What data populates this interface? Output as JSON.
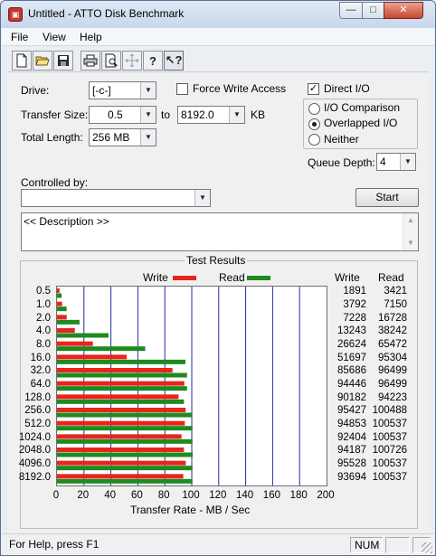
{
  "window": {
    "title": "Untitled - ATTO Disk Benchmark"
  },
  "menu": [
    "File",
    "View",
    "Help"
  ],
  "toolbar_icons": [
    "new-file-icon",
    "open-folder-icon",
    "save-icon",
    "print-icon",
    "print-preview-icon",
    "move-icon",
    "help-icon",
    "context-help-icon"
  ],
  "form": {
    "drive_label": "Drive:",
    "drive_value": "[-c-]",
    "force_write_label": "Force Write Access",
    "force_write_checked": false,
    "direct_io_label": "Direct I/O",
    "direct_io_checked": true,
    "transfer_size_label": "Transfer Size:",
    "transfer_from": "0.5",
    "to_label": "to",
    "transfer_to": "8192.0",
    "kb_label": "KB",
    "total_length_label": "Total Length:",
    "total_length_value": "256 MB",
    "io_options": [
      "I/O Comparison",
      "Overlapped I/O",
      "Neither"
    ],
    "io_selected": "Overlapped I/O",
    "queue_depth_label": "Queue Depth:",
    "queue_depth_value": "4",
    "controlled_by_label": "Controlled by:",
    "controlled_by_value": "",
    "start_label": "Start",
    "description": "<< Description >>"
  },
  "results": {
    "title": "Test Results",
    "write_label": "Write",
    "read_label": "Read",
    "write_color": "#e8251c",
    "read_color": "#1f8a1f",
    "axis_label": "Transfer Rate - MB / Sec"
  },
  "chart_data": {
    "type": "bar",
    "title": "Test Results",
    "xlabel": "Transfer Rate - MB / Sec",
    "ylabel": "",
    "xlim": [
      0,
      200
    ],
    "x_ticks": [
      0,
      20,
      40,
      60,
      80,
      100,
      120,
      140,
      160,
      180,
      200
    ],
    "grid": true,
    "legend": "top",
    "categories": [
      "0.5",
      "1.0",
      "2.0",
      "4.0",
      "8.0",
      "16.0",
      "32.0",
      "64.0",
      "128.0",
      "256.0",
      "512.0",
      "1024.0",
      "2048.0",
      "4096.0",
      "8192.0"
    ],
    "series": [
      {
        "name": "Write",
        "values": [
          1891,
          3792,
          7228,
          13243,
          26624,
          51697,
          85686,
          94446,
          90182,
          95427,
          94853,
          92404,
          94187,
          95528,
          93694
        ]
      },
      {
        "name": "Read",
        "values": [
          3421,
          7150,
          16728,
          38242,
          65472,
          95304,
          96499,
          96499,
          94223,
          100488,
          100537,
          100537,
          100726,
          100537,
          100537
        ]
      }
    ]
  },
  "status": {
    "help_text": "For Help, press F1",
    "num_text": "NUM"
  }
}
